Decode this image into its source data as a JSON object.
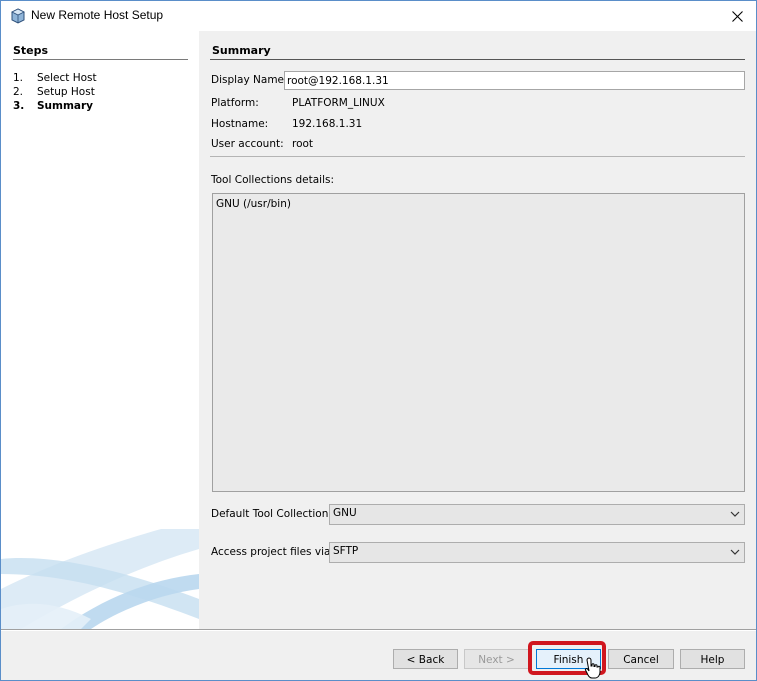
{
  "window": {
    "title": "New Remote Host Setup"
  },
  "steps": {
    "heading": "Steps",
    "items": [
      {
        "number": "1.",
        "label": "Select Host"
      },
      {
        "number": "2.",
        "label": "Setup Host"
      },
      {
        "number": "3.",
        "label": "Summary"
      }
    ],
    "current_index": 2
  },
  "summary": {
    "heading": "Summary",
    "display_name_label": "Display Name:",
    "display_name_value": "root@192.168.1.31",
    "platform_label": "Platform:",
    "platform_value": "PLATFORM_LINUX",
    "hostname_label": "Hostname:",
    "hostname_value": "192.168.1.31",
    "user_label": "User account:",
    "user_value": "root",
    "tool_details_label": "Tool Collections details:",
    "tool_details_text": "GNU (/usr/bin)",
    "default_tool_label": "Default Tool Collection:",
    "default_tool_value": "GNU",
    "access_label": "Access project files via:",
    "access_value": "SFTP"
  },
  "buttons": {
    "back": "< Back",
    "next": "Next >",
    "finish": "Finish",
    "cancel": "Cancel",
    "help": "Help"
  },
  "colors": {
    "highlight": "#d0161e",
    "window_border": "#5a8ec9",
    "primary_button_border": "#0078d7"
  }
}
